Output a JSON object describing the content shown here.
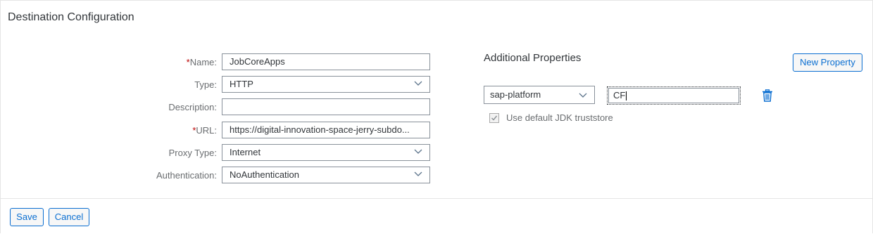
{
  "title": "Destination Configuration",
  "form": {
    "required_marker": "*",
    "name": {
      "label": "Name:",
      "value": "JobCoreApps"
    },
    "type": {
      "label": "Type:",
      "value": "HTTP"
    },
    "description": {
      "label": "Description:",
      "value": ""
    },
    "url": {
      "label": "URL:",
      "value": "https://digital-innovation-space-jerry-subdo..."
    },
    "proxy_type": {
      "label": "Proxy Type:",
      "value": "Internet"
    },
    "authentication": {
      "label": "Authentication:",
      "value": "NoAuthentication"
    }
  },
  "additional_properties": {
    "title": "Additional Properties",
    "new_property_label": "New Property",
    "property_key": "sap-platform",
    "property_value": "CF",
    "checkbox_label": "Use default JDK truststore",
    "checkbox_checked": true
  },
  "footer": {
    "save_label": "Save",
    "cancel_label": "Cancel"
  },
  "colors": {
    "accent": "#0a6ed1",
    "required": "#bb0000",
    "label": "#6a6d70",
    "text": "#32363a"
  },
  "icons": [
    "chevron-down-icon",
    "trash-icon",
    "checkmark-icon"
  ]
}
